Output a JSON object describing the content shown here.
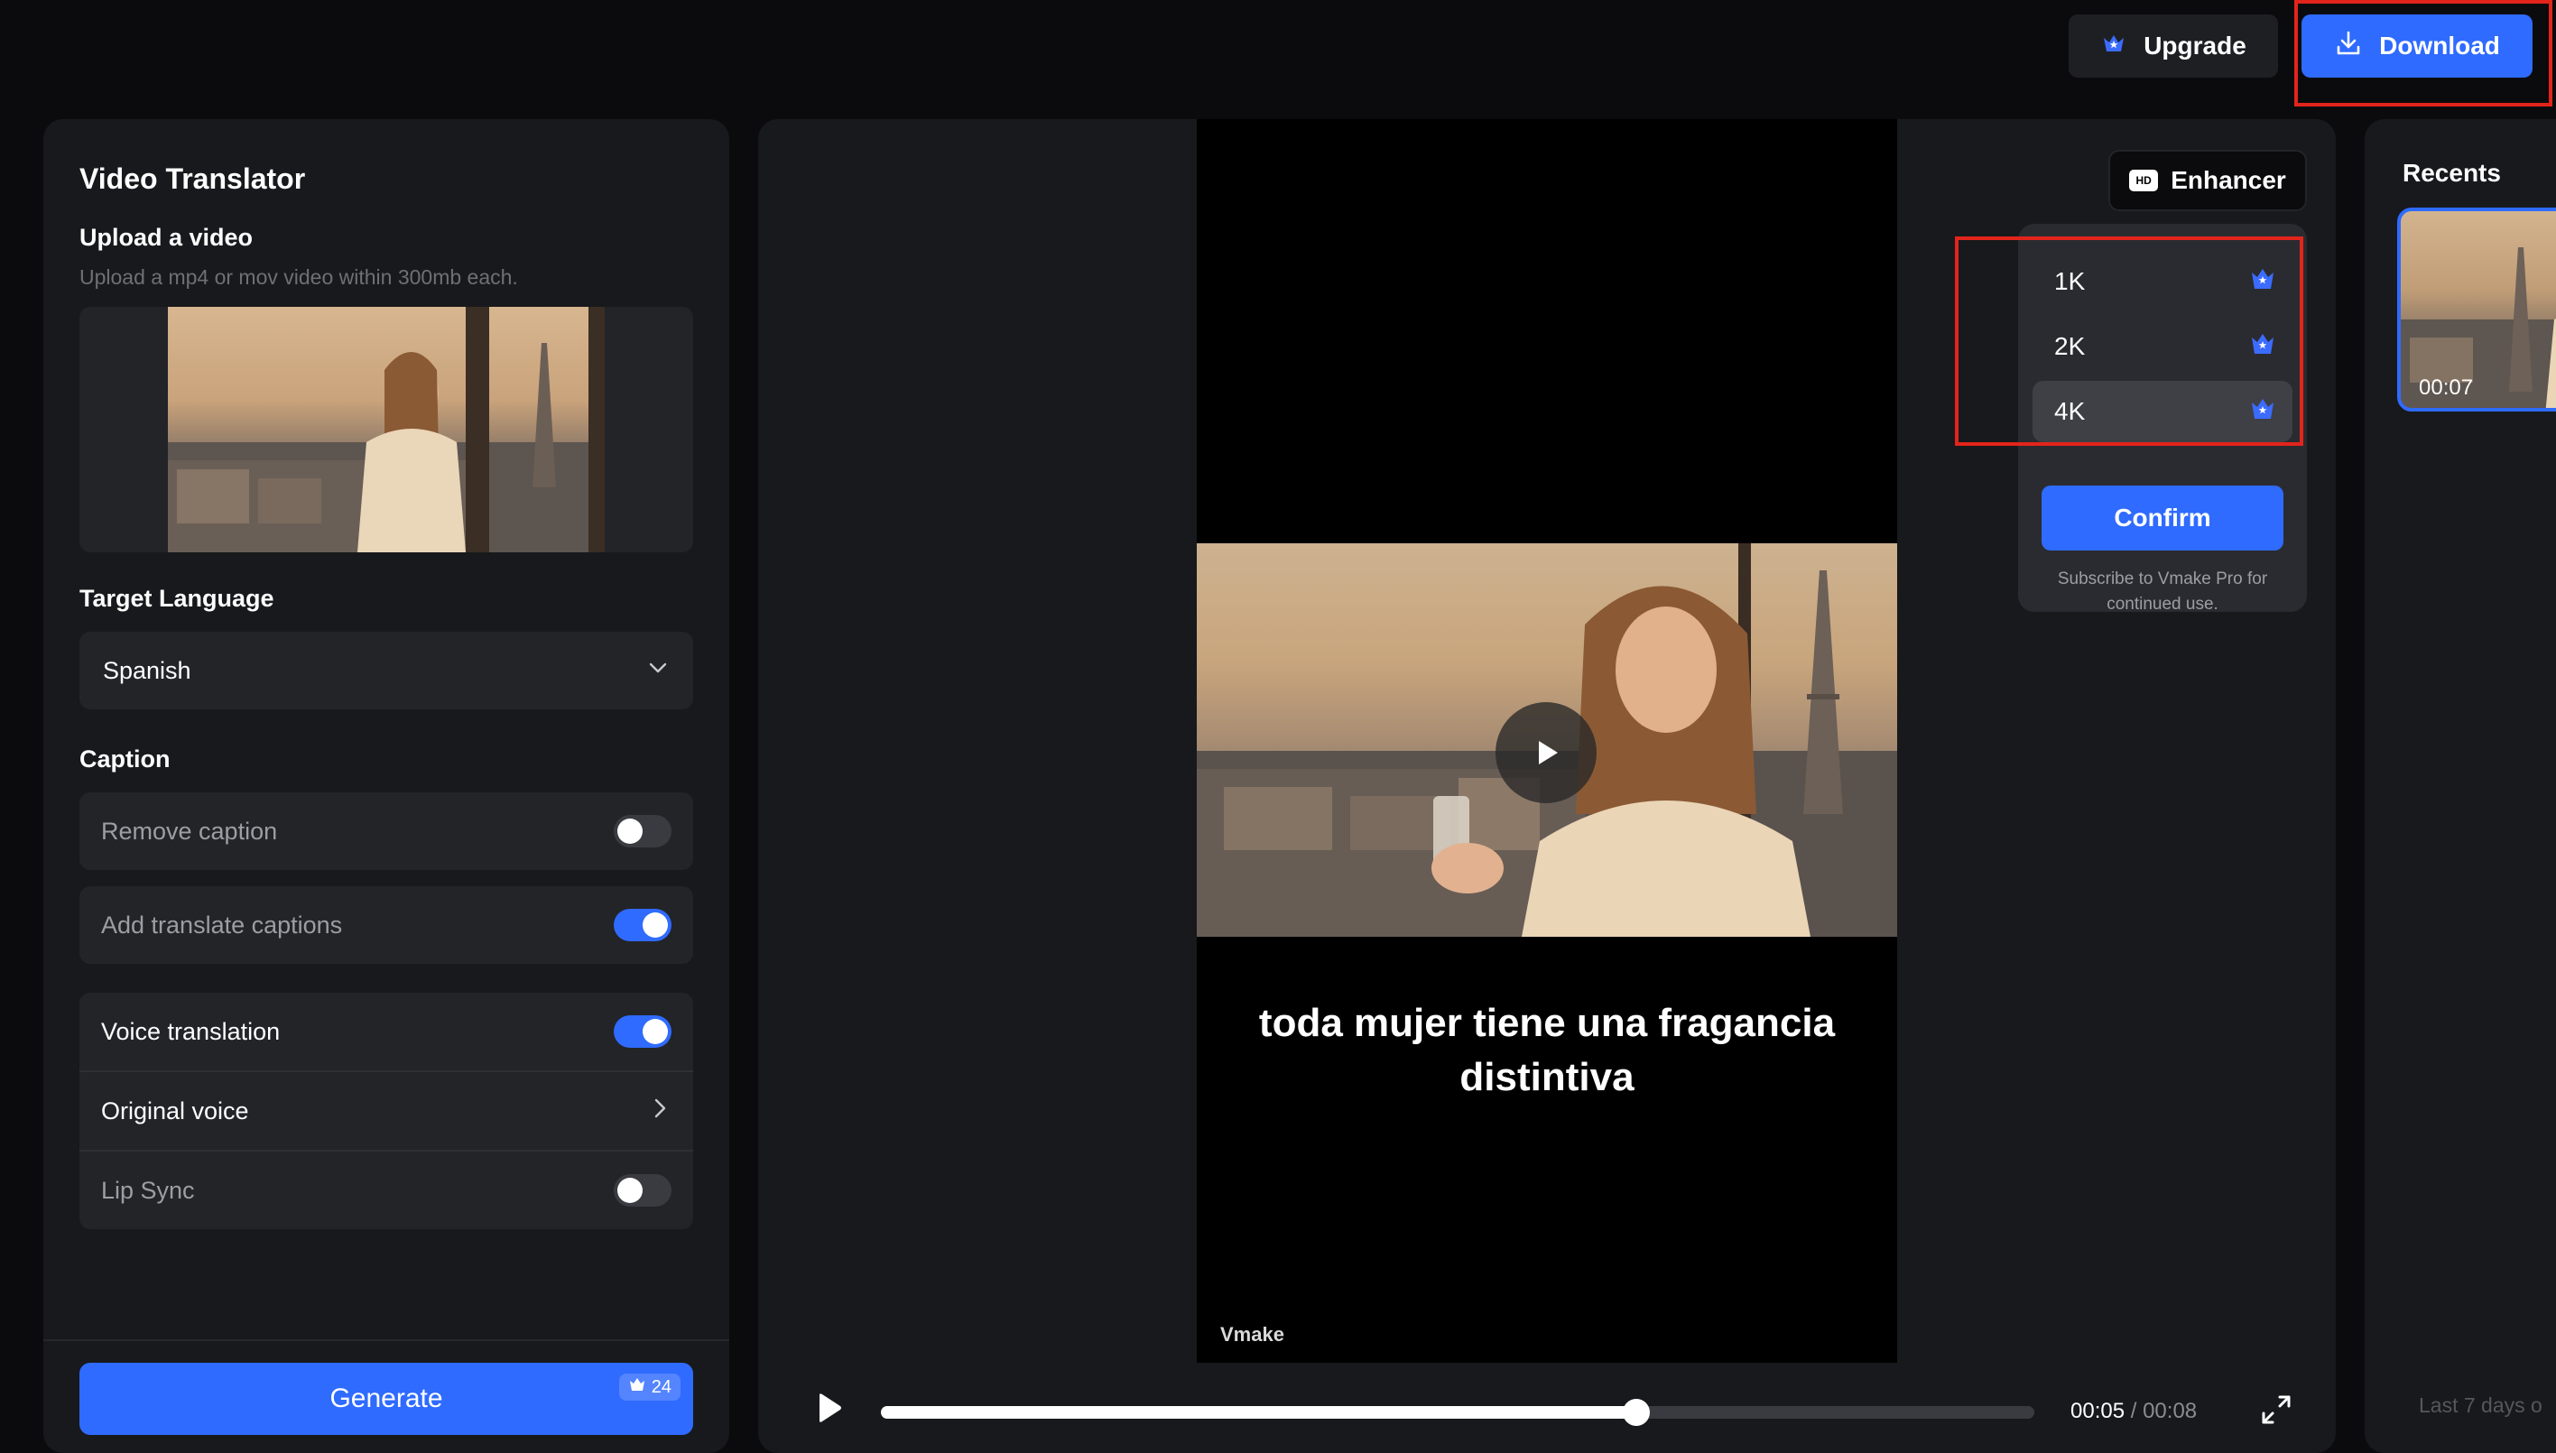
{
  "header": {
    "upgrade_label": "Upgrade",
    "download_label": "Download"
  },
  "left_panel": {
    "title": "Video Translator",
    "upload_title": "Upload a video",
    "upload_subtitle": "Upload a mp4 or mov video within 300mb each.",
    "target_language_label": "Target Language",
    "target_language_value": "Spanish",
    "caption_label": "Caption",
    "remove_caption_label": "Remove caption",
    "add_translate_captions_label": "Add translate captions",
    "voice_translation_label": "Voice translation",
    "original_voice_label": "Original voice",
    "lip_sync_label": "Lip Sync",
    "generate_label": "Generate",
    "credits": "24"
  },
  "toggles": {
    "remove_caption": false,
    "add_translate_captions": true,
    "voice_translation": true,
    "lip_sync": false
  },
  "preview": {
    "caption_text": "toda mujer tiene una fragancia distintiva",
    "watermark": "Vmake",
    "current_time": "00:05",
    "time_separator": "/",
    "duration": "00:08",
    "progress_percent": 65.5
  },
  "enhancer": {
    "button_label": "Enhancer",
    "hd_badge": "HD",
    "options": [
      "1K",
      "2K",
      "4K"
    ],
    "selected": "4K",
    "confirm_label": "Confirm",
    "note": "Subscribe to Vmake Pro for continued use."
  },
  "recents": {
    "title": "Recents",
    "item_duration": "00:07",
    "footer": "Last 7 days o"
  },
  "colors": {
    "accent": "#2f6bff",
    "highlight": "#e3241b",
    "panel": "#18191c",
    "background": "#0b0b0d"
  }
}
